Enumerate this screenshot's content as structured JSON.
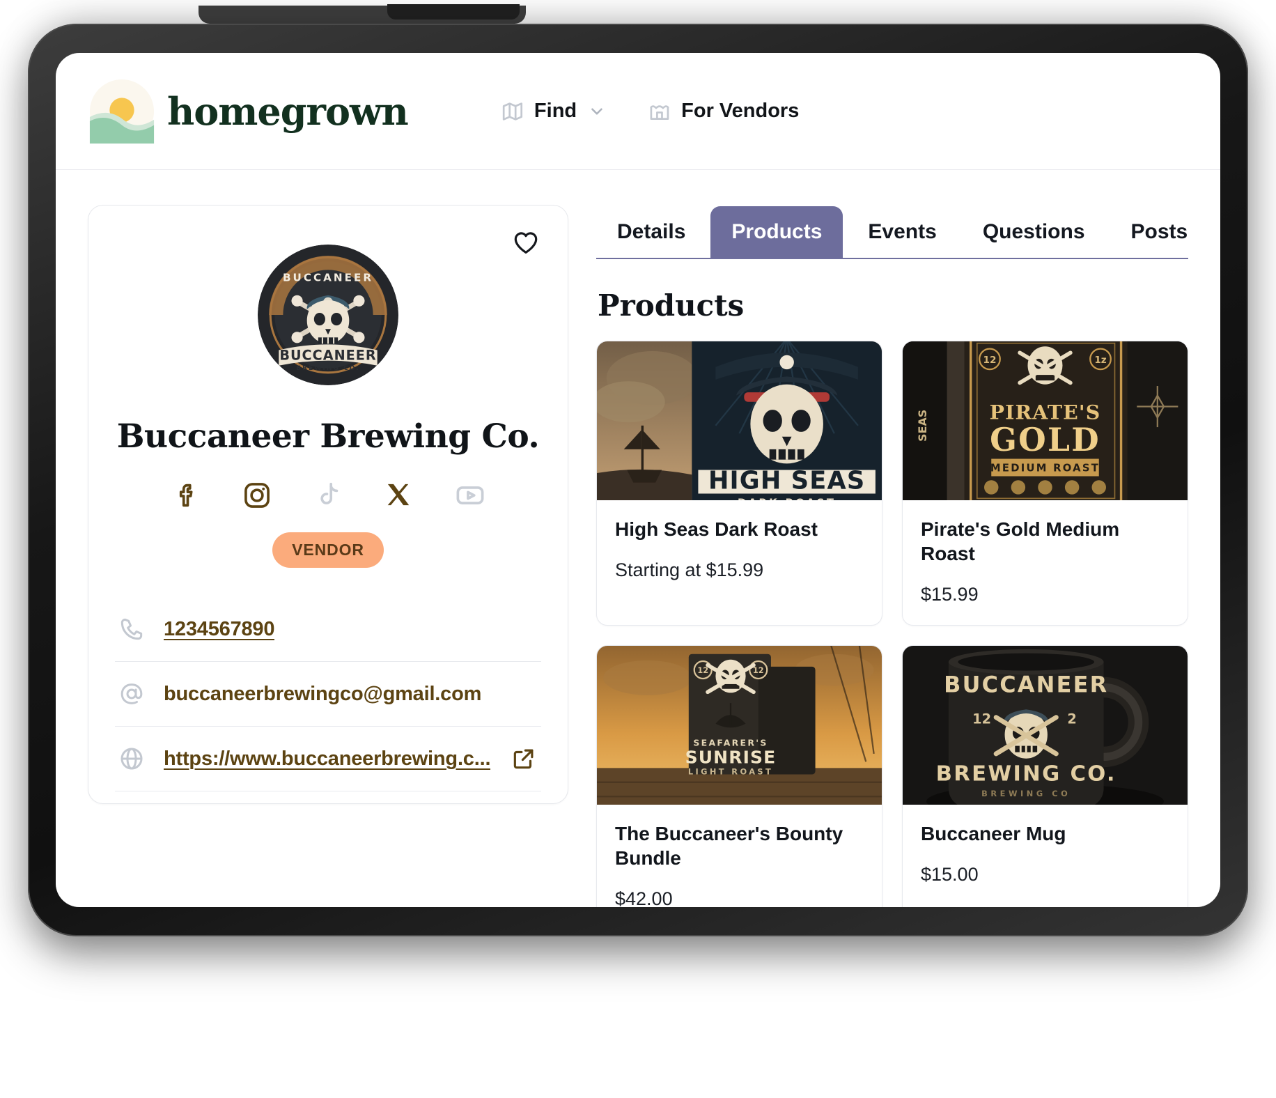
{
  "header": {
    "brand_name": "homegrown",
    "brand_logo_icon": "sunrise-logo-icon",
    "nav": [
      {
        "label": "Find",
        "icon": "map-icon",
        "has_dropdown": true
      },
      {
        "label": "For Vendors",
        "icon": "storefront-icon",
        "has_dropdown": false
      }
    ]
  },
  "vendor": {
    "name": "Buccaneer Brewing Co.",
    "logo_icon": "buccaneer-brewing-logo-icon",
    "favorite_icon": "heart-outline-icon",
    "badge": "VENDOR",
    "socials": [
      {
        "name": "facebook",
        "icon": "facebook-icon",
        "active": true
      },
      {
        "name": "instagram",
        "icon": "instagram-icon",
        "active": true
      },
      {
        "name": "tiktok",
        "icon": "tiktok-icon",
        "active": false
      },
      {
        "name": "x",
        "icon": "x-twitter-icon",
        "active": true
      },
      {
        "name": "youtube",
        "icon": "youtube-icon",
        "active": false
      }
    ],
    "contacts": [
      {
        "type": "phone",
        "icon": "phone-icon",
        "value": "1234567890",
        "link": true
      },
      {
        "type": "email",
        "icon": "at-sign-icon",
        "value": "buccaneerbrewingco@gmail.com",
        "link": false
      },
      {
        "type": "website",
        "icon": "globe-icon",
        "value": "https://www.buccaneerbrewing.c...",
        "link": true,
        "external_icon": "external-link-icon"
      }
    ]
  },
  "tabs": [
    {
      "label": "Details",
      "active": false
    },
    {
      "label": "Products",
      "active": true
    },
    {
      "label": "Events",
      "active": false
    },
    {
      "label": "Questions",
      "active": false
    },
    {
      "label": "Posts",
      "active": false
    }
  ],
  "products_section": {
    "title": "Products",
    "items": [
      {
        "name": "High Seas Dark Roast",
        "price": "Starting at $15.99",
        "image_alt": "high-seas-dark-roast-coffee-bag"
      },
      {
        "name": "Pirate's Gold Medium Roast",
        "price": "$15.99",
        "image_alt": "pirates-gold-medium-roast-coffee-bag"
      },
      {
        "name": "The Buccaneer's Bounty Bundle",
        "price": "$42.00",
        "image_alt": "buccaneers-bounty-bundle"
      },
      {
        "name": "Buccaneer Mug",
        "price": "$15.00",
        "image_alt": "buccaneer-mug"
      }
    ]
  },
  "colors": {
    "brand_green": "#12301f",
    "accent_purple": "#6d6d9c",
    "badge_orange": "#fbab7c",
    "link_brown": "#5c4312",
    "border": "#e7e9ee"
  }
}
